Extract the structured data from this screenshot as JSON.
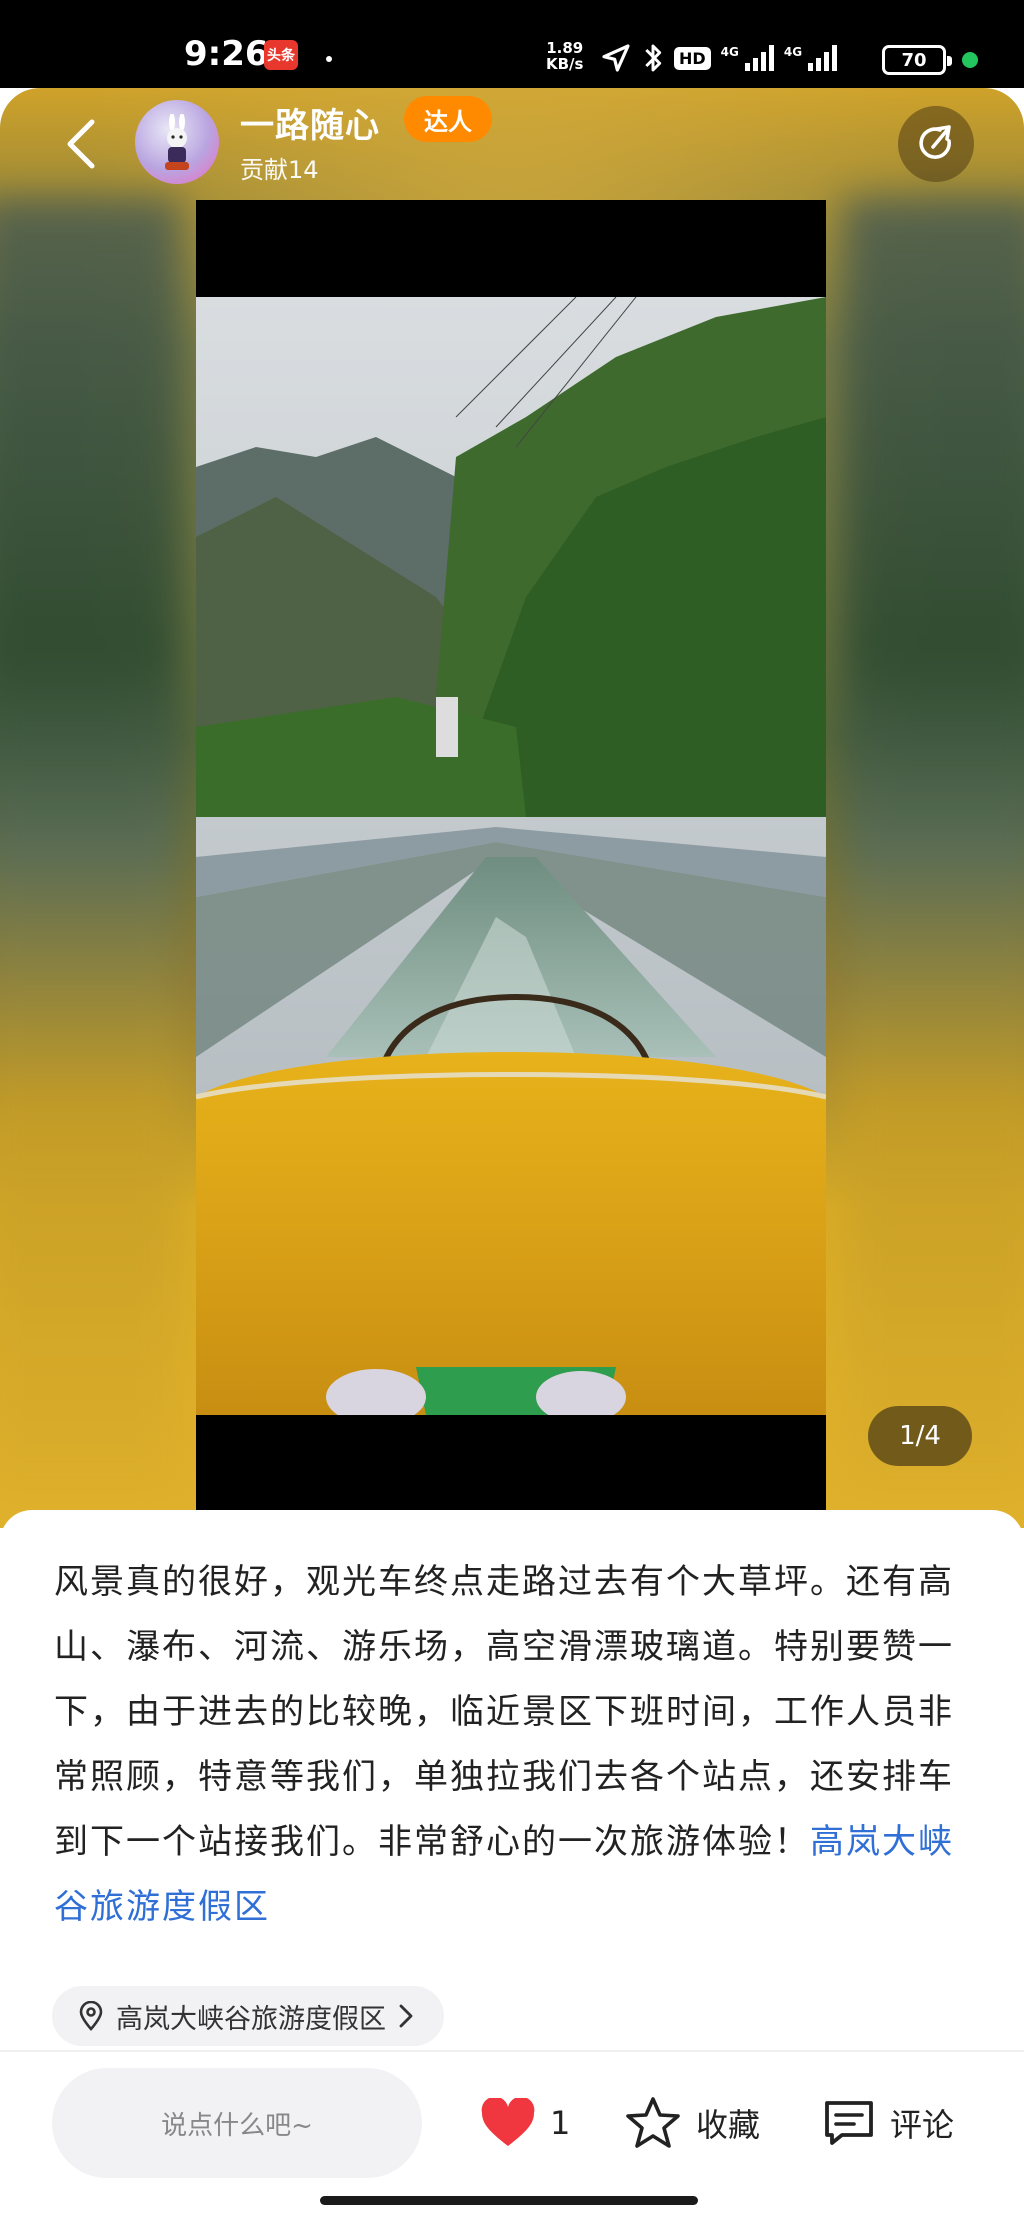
{
  "status_bar": {
    "time": "9:26",
    "app_badge": "头条",
    "net_speed_value": "1.89",
    "net_speed_unit": "KB/s",
    "hd_label": "HD",
    "signal_1_label": "4G",
    "signal_2_label": "4G",
    "battery": "70",
    "icons": [
      "location-arrow-icon",
      "bluetooth-icon",
      "signal-icon",
      "battery-icon"
    ]
  },
  "header": {
    "author_name": "一路随心",
    "badge": "达人",
    "contribution": "贡献14",
    "icons": [
      "back-icon",
      "share-icon"
    ]
  },
  "gallery": {
    "page_indicator": "1/4"
  },
  "post": {
    "text": "风景真的很好，观光车终点走路过去有个大草坪。还有高山、瀑布、河流、游乐场，高空滑漂玻璃道。特别要赞一下，由于进去的比较晚，临近景区下班时间，工作人员非常照顾，特意等我们，单独拉我们去各个站点，还安排车到下一个站接我们。非常舒心的一次旅游体验！",
    "tag_link": "高岚大峡谷旅游度假区",
    "location": "高岚大峡谷旅游度假区"
  },
  "bottom_bar": {
    "comment_placeholder": "说点什么吧~",
    "like_count": "1",
    "favorite_label": "收藏",
    "comment_label": "评论"
  },
  "colors": {
    "accent_link": "#2f6fd6",
    "badge_orange": "#ff8a00",
    "like_red": "#f0363f"
  }
}
